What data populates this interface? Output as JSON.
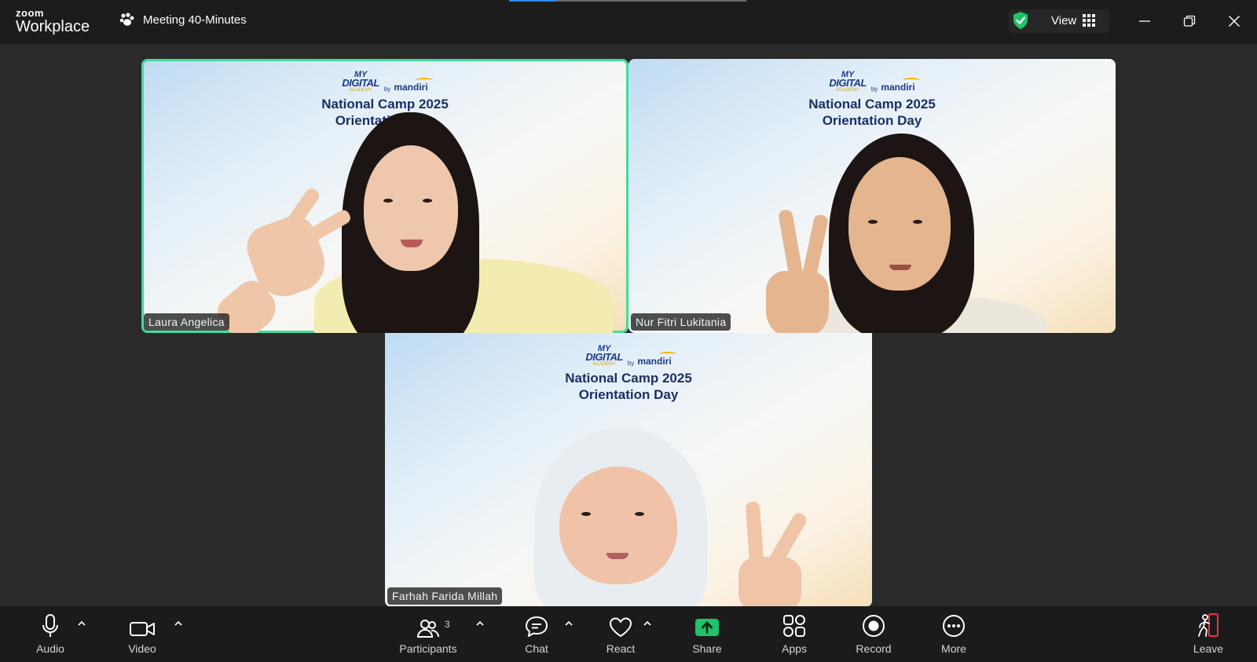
{
  "app": {
    "brand_line1": "zoom",
    "brand_line2": "Workplace"
  },
  "meeting": {
    "title": "Meeting 40-Minutes",
    "timer_progress": 0.2
  },
  "header": {
    "view_label": "View"
  },
  "colors": {
    "active_speaker": "#3fdd9a",
    "share_green": "#1fc36a",
    "leave_red": "#e8334a",
    "accent_blue": "#2d8cff"
  },
  "tiles": [
    {
      "name": "Laura Angelica",
      "banner_line1": "National Camp 2025",
      "banner_line2": "Orientation Day",
      "brand_my": "MY",
      "brand_digital": "DIGITAL",
      "brand_academy": "ACADEMY",
      "brand_by": "by",
      "brand_mandiri": "mandiri",
      "active": true
    },
    {
      "name": "Nur Fitri Lukitania",
      "banner_line1": "National Camp 2025",
      "banner_line2": "Orientation Day",
      "brand_my": "MY",
      "brand_digital": "DIGITAL",
      "brand_academy": "ACADEMY",
      "brand_by": "by",
      "brand_mandiri": "mandiri",
      "active": false
    },
    {
      "name": "Farhah Farida Millah",
      "banner_line1": "National Camp 2025",
      "banner_line2": "Orientation Day",
      "brand_my": "MY",
      "brand_digital": "DIGITAL",
      "brand_academy": "ACADEMY",
      "brand_by": "by",
      "brand_mandiri": "mandiri",
      "active": false
    }
  ],
  "toolbar": {
    "audio": "Audio",
    "video": "Video",
    "participants": "Participants",
    "participants_count": "3",
    "chat": "Chat",
    "react": "React",
    "share": "Share",
    "apps": "Apps",
    "record": "Record",
    "more": "More",
    "leave": "Leave"
  }
}
